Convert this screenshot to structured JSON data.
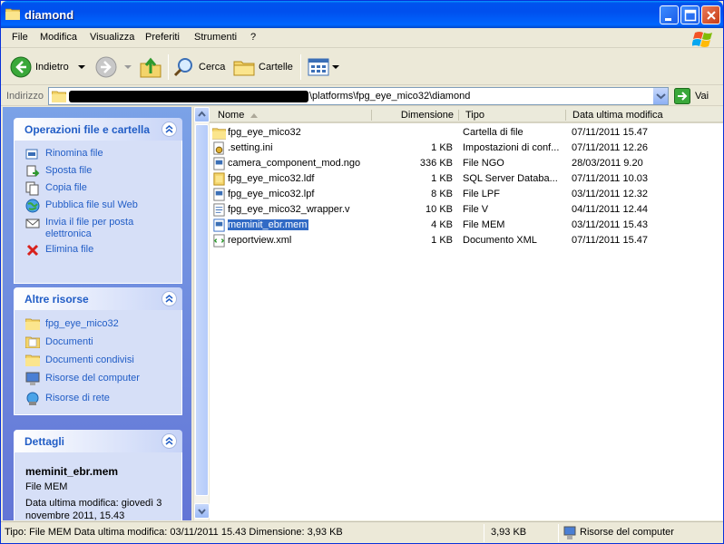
{
  "window": {
    "title": "diamond"
  },
  "menu": [
    "File",
    "Modifica",
    "Visualizza",
    "Preferiti",
    "Strumenti",
    "?"
  ],
  "toolbar": {
    "back": "Indietro",
    "search": "Cerca",
    "folders": "Cartelle"
  },
  "address": {
    "label": "Indirizzo",
    "path_visible": "\\platforms\\fpg_eye_mico32\\diamond",
    "go": "Vai"
  },
  "taskpane": {
    "file_tasks": {
      "title": "Operazioni file e cartella",
      "items": [
        {
          "label": "Rinomina file",
          "icon": "rename-icon"
        },
        {
          "label": "Sposta file",
          "icon": "move-icon"
        },
        {
          "label": "Copia file",
          "icon": "copy-icon"
        },
        {
          "label": "Pubblica file sul Web",
          "icon": "publish-web-icon"
        },
        {
          "label": "Invia il file per posta elettronica",
          "icon": "email-icon"
        },
        {
          "label": "Elimina file",
          "icon": "delete-icon"
        }
      ]
    },
    "other_places": {
      "title": "Altre risorse",
      "items": [
        {
          "label": "fpg_eye_mico32",
          "icon": "folder-icon"
        },
        {
          "label": "Documenti",
          "icon": "documents-folder-icon"
        },
        {
          "label": "Documenti condivisi",
          "icon": "shared-folder-icon"
        },
        {
          "label": "Risorse del computer",
          "icon": "computer-icon"
        },
        {
          "label": "Risorse di rete",
          "icon": "network-icon"
        }
      ]
    },
    "details": {
      "title": "Dettagli",
      "name": "meminit_ebr.mem",
      "type": "File MEM",
      "modified": "Data ultima modifica: giovedì 3 novembre 2011, 15.43"
    }
  },
  "columns": [
    "Nome",
    "Dimensione",
    "Tipo",
    "Data ultima modifica"
  ],
  "files": [
    {
      "name": "fpg_eye_mico32",
      "size": "",
      "type": "Cartella di file",
      "date": "07/11/2011 15.47",
      "icon": "folder-icon"
    },
    {
      "name": ".setting.ini",
      "size": "1 KB",
      "type": "Impostazioni di conf...",
      "date": "07/11/2011 12.26",
      "icon": "ini-file-icon"
    },
    {
      "name": "camera_component_mod.ngo",
      "size": "336 KB",
      "type": "File NGO",
      "date": "28/03/2011 9.20",
      "icon": "generic-file-icon"
    },
    {
      "name": "fpg_eye_mico32.ldf",
      "size": "1 KB",
      "type": "SQL Server Databa...",
      "date": "07/11/2011 10.03",
      "icon": "sql-file-icon"
    },
    {
      "name": "fpg_eye_mico32.lpf",
      "size": "8 KB",
      "type": "File LPF",
      "date": "03/11/2011 12.32",
      "icon": "generic-file-icon"
    },
    {
      "name": "fpg_eye_mico32_wrapper.v",
      "size": "10 KB",
      "type": "File V",
      "date": "04/11/2011 12.44",
      "icon": "text-file-icon"
    },
    {
      "name": "meminit_ebr.mem",
      "size": "4 KB",
      "type": "File MEM",
      "date": "03/11/2011 15.43",
      "icon": "generic-file-icon",
      "selected": true
    },
    {
      "name": "reportview.xml",
      "size": "1 KB",
      "type": "Documento XML",
      "date": "07/11/2011 15.47",
      "icon": "xml-file-icon"
    }
  ],
  "status": {
    "info": "Tipo: File MEM Data ultima modifica: 03/11/2011 15.43 Dimensione: 3,93 KB",
    "size": "3,93 KB",
    "zone": "Risorse del computer"
  }
}
